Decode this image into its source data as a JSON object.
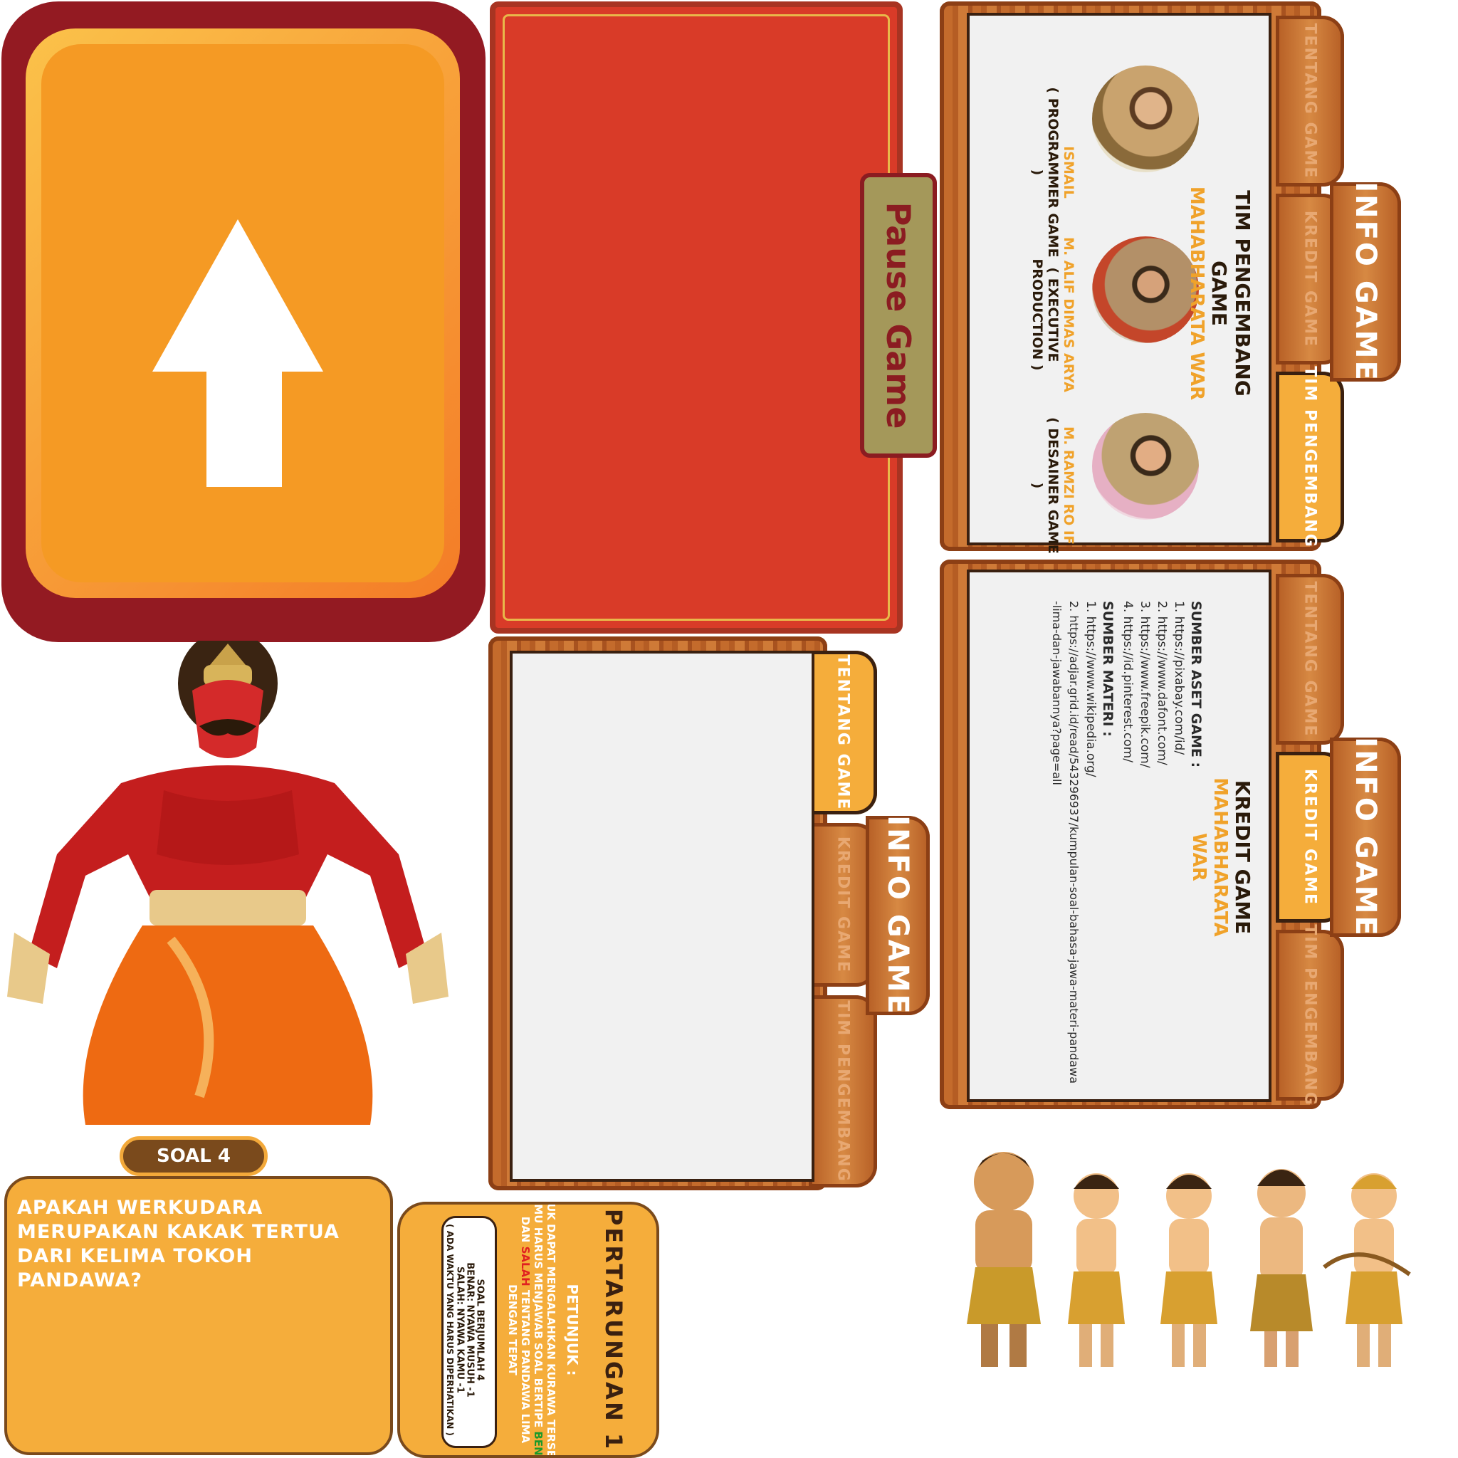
{
  "up_button": {
    "icon": "arrow-up-icon"
  },
  "pause": {
    "label": "Pause Game"
  },
  "info_panel_team": {
    "tabs": [
      "TENTANG GAME",
      "KREDIT GAME",
      "TIM PENGEMBANG"
    ],
    "side_tab": "INFO GAME",
    "title": "TIM PENGEMBANG GAME",
    "subtitle": "MAHABHARATA WAR",
    "members": [
      {
        "name": "ISMAIL",
        "role": "( PROGRAMMER GAME )"
      },
      {
        "name": "M. ALIF DIMAS ARYA",
        "role": "( EXECUTIVE PRODUCTION )"
      },
      {
        "name": "M. RAMZI RO IF",
        "role": "( DESAINER GAME )"
      }
    ]
  },
  "info_panel_blank": {
    "tabs": [
      "TENTANG GAME",
      "KREDIT GAME",
      "TIM PENGEMBANG"
    ],
    "side_tab": "INFO GAME"
  },
  "info_panel_credit": {
    "tabs": [
      "TENTANG GAME",
      "KREDIT GAME",
      "TIM PENGEMBANG"
    ],
    "side_tab": "INFO GAME",
    "title": "KREDIT GAME",
    "subtitle": "MAHABHARATA WAR",
    "assets_heading": "SUMBER ASET GAME :",
    "assets": [
      "1. https://pixabay.com/id/",
      "2. https://www.dafont.com/",
      "3. https://www.freepik.com/",
      "4. https://id.pinterest.com/"
    ],
    "materials_heading": "SUMBER MATERI :",
    "materials": [
      "1. https://www.wikipedia.org/",
      "2. https://adjar.grid.id/read/543296937/kumpulan-soal-bahasa-jawa-materi-pandawa",
      "-lima-dan-jawabannya?page=all"
    ]
  },
  "question": {
    "badge": "SOAL 4",
    "text": "APAKAH WERKUDARA MERUPAKAN KAKAK TERTUA DARI KELIMA TOKOH PANDAWA?"
  },
  "instructions": {
    "title": "PERTARUNGAN 1",
    "heading": "PETUNJUK :",
    "line1": "UNTUK DAPAT MENGALAHKAN KURAWA TERSEBUT",
    "line2_pre": "KAMU HARUS MENJAWAB SOAL BERTIPE ",
    "benar": "BENAR",
    "line3_pre": "DAN ",
    "salah": "SALAH",
    "line3_post": " TENTANG PANDAWA LIMA",
    "line4": "DENGAN TEPAT",
    "box_lines": [
      "SOAL BERJUMLAH 4",
      "BENAR: NYAWA MUSUH -1",
      "SALAH: NYAWA KAMU -1",
      "( ADA WAKTU YANG HARUS DIPERHATIKAN )"
    ]
  },
  "colors": {
    "benar": "#1a9a2a",
    "salah": "#e02020",
    "accent": "#f0a22a"
  }
}
